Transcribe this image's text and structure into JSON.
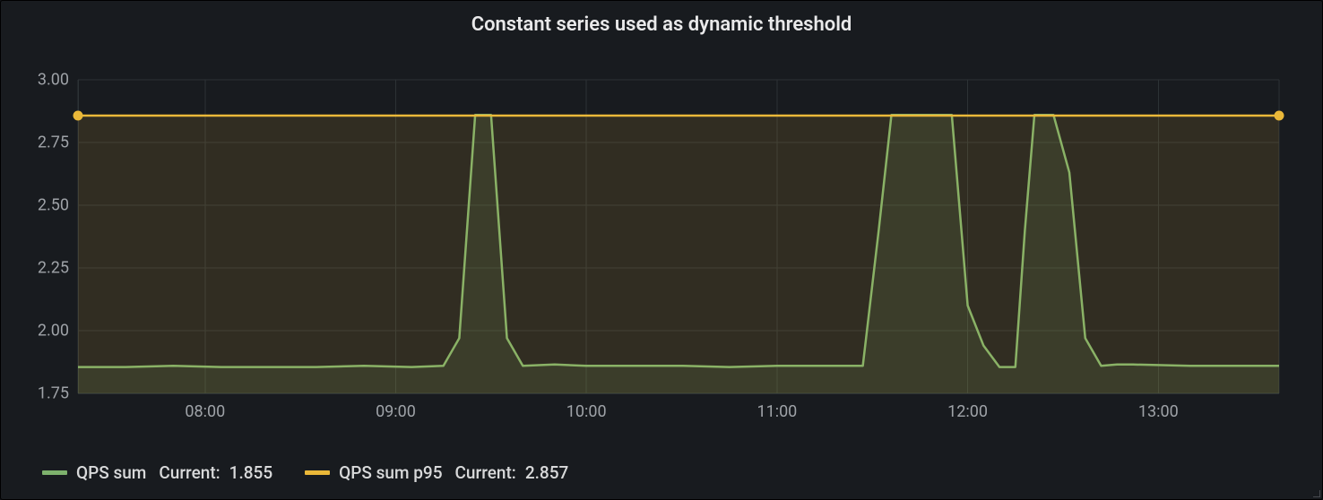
{
  "title": "Constant series used as dynamic threshold",
  "legend": {
    "series1": {
      "name": "QPS sum",
      "statLabel": "Current:",
      "statValue": "1.855",
      "color": "#7EB26D"
    },
    "series2": {
      "name": "QPS sum p95",
      "statLabel": "Current:",
      "statValue": "2.857",
      "color": "#EAB839"
    }
  },
  "chart_data": {
    "type": "line",
    "title": "Constant series used as dynamic threshold",
    "xlabel": "",
    "ylabel": "",
    "ylim": [
      1.75,
      3.0
    ],
    "y_ticks": [
      1.75,
      2.0,
      2.25,
      2.5,
      2.75,
      3.0
    ],
    "x_ticks": [
      "08:00",
      "09:00",
      "10:00",
      "11:00",
      "12:00",
      "13:00"
    ],
    "x_range_minutes": [
      440,
      818
    ],
    "series": [
      {
        "name": "QPS sum",
        "color": "#7EB26D",
        "fill": true,
        "x_minutes": [
          440,
          455,
          470,
          485,
          500,
          515,
          530,
          545,
          555,
          560,
          565,
          570,
          575,
          580,
          590,
          600,
          615,
          630,
          645,
          660,
          675,
          687,
          692,
          696,
          700,
          715,
          720,
          725,
          730,
          735,
          738,
          741,
          744,
          747,
          752,
          757,
          762,
          767,
          772,
          790,
          805,
          818
        ],
        "y": [
          1.855,
          1.855,
          1.86,
          1.855,
          1.855,
          1.855,
          1.86,
          1.855,
          1.86,
          1.97,
          2.86,
          2.86,
          1.97,
          1.86,
          1.865,
          1.86,
          1.86,
          1.86,
          1.855,
          1.86,
          1.86,
          1.86,
          2.4,
          2.86,
          2.86,
          2.86,
          2.1,
          1.94,
          1.855,
          1.855,
          2.4,
          2.86,
          2.86,
          2.86,
          2.63,
          1.97,
          1.86,
          1.865,
          1.865,
          1.86,
          1.86,
          1.86
        ]
      },
      {
        "name": "QPS sum p95",
        "color": "#EAB839",
        "fill": true,
        "endpoint_markers": true,
        "x_minutes": [
          440,
          818
        ],
        "y": [
          2.857,
          2.857
        ]
      }
    ]
  }
}
